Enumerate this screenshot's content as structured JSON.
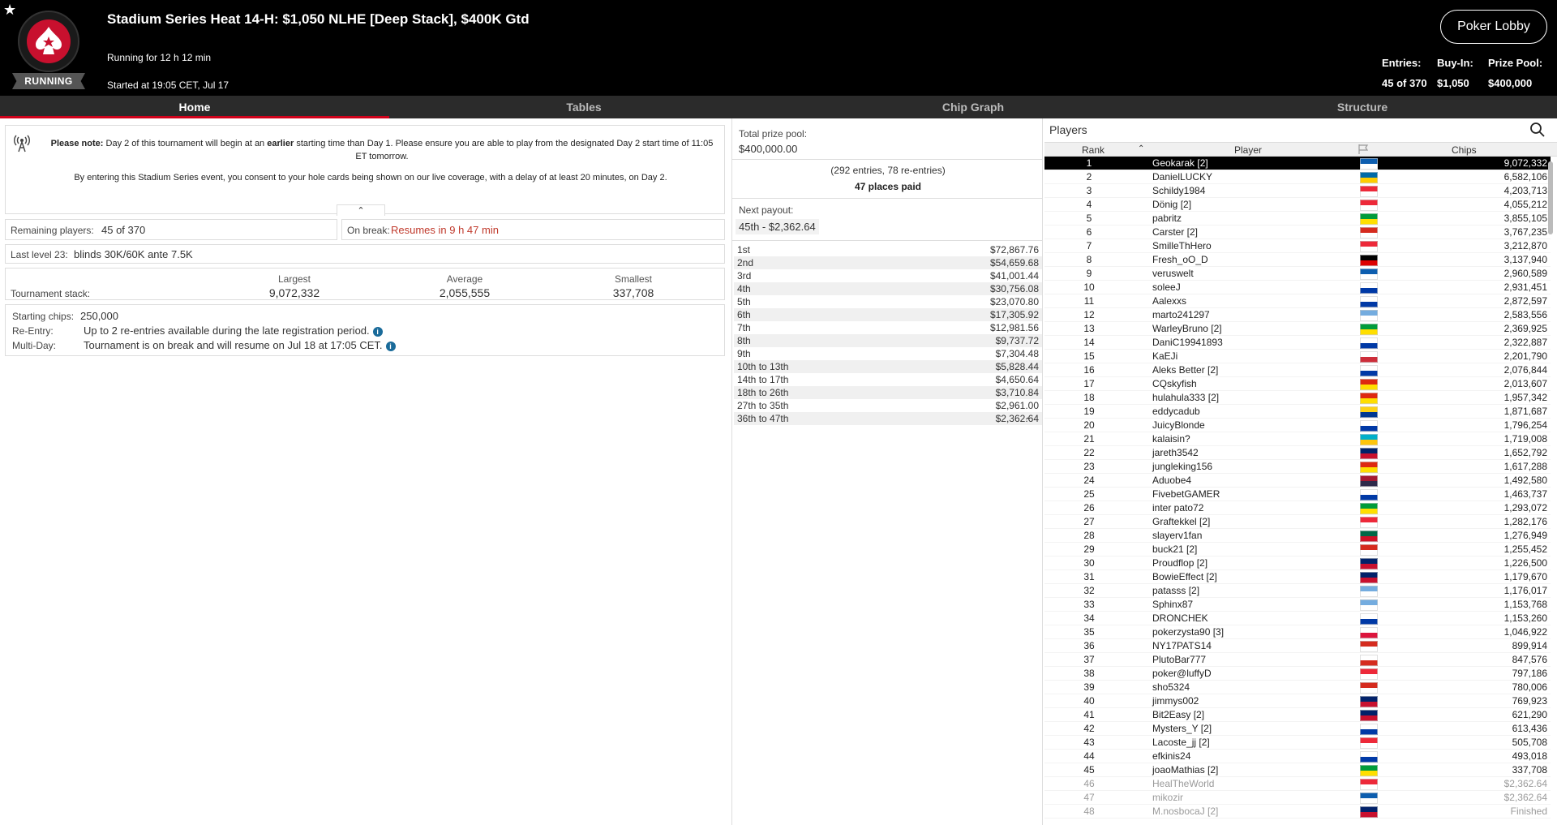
{
  "header": {
    "title": "Stadium Series Heat 14-H: $1,050 NLHE [Deep Stack], $400K Gtd",
    "status_badge": "RUNNING",
    "running_for": "Running for 12 h 12 min",
    "started_at": "Started at 19:05 CET, Jul 17",
    "lobby_button": "Poker Lobby",
    "entries_label": "Entries:",
    "entries_value": "45 of 370",
    "buyin_label": "Buy-In:",
    "buyin_value": "$1,050",
    "prizepool_label": "Prize Pool:",
    "prizepool_value": "$400,000"
  },
  "tabs": [
    {
      "label": "Home",
      "active": true
    },
    {
      "label": "Tables",
      "active": false
    },
    {
      "label": "Chip Graph",
      "active": false
    },
    {
      "label": "Structure",
      "active": false
    }
  ],
  "notice": {
    "bold_prefix": "Please note:",
    "text1": " Day 2 of this tournament will begin at an ",
    "bold_mid": "earlier",
    "text2": " starting time than Day 1. Please ensure you are able to play from the designated Day 2 start time of 11:05 ET tomorrow.",
    "text3": "By entering this Stadium Series event, you consent to your hole cards being shown on our live coverage, with a delay of at least 20 minutes, on Day 2."
  },
  "remaining": {
    "label": "Remaining players:",
    "value": "45 of 370"
  },
  "on_break": {
    "label": "On break:",
    "value": "Resumes in 9 h 47 min"
  },
  "last_level": {
    "label": "Last level 23:",
    "value": "blinds 30K/60K ante 7.5K"
  },
  "stack": {
    "label": "Tournament stack:",
    "largest_label": "Largest",
    "largest": "9,072,332",
    "average_label": "Average",
    "average": "2,055,555",
    "smallest_label": "Smallest",
    "smallest": "337,708"
  },
  "info": {
    "starting_label": "Starting chips:",
    "starting_value": "250,000",
    "reentry_label": "Re-Entry:",
    "reentry_value": "Up to 2 re-entries available during the late registration period.",
    "multiday_label": "Multi-Day:",
    "multiday_value": "Tournament is on break and will resume on Jul 18 at 17:05 CET."
  },
  "prize": {
    "total_label": "Total prize pool:",
    "total_value": "$400,000.00",
    "entries_text": "(292 entries, 78 re-entries)",
    "places_paid": "47 places paid",
    "next_payout_label": "Next payout:",
    "next_payout_value": "45th - $2,362.64",
    "payouts": [
      {
        "place": "1st",
        "amount": "$72,867.76"
      },
      {
        "place": "2nd",
        "amount": "$54,659.68"
      },
      {
        "place": "3rd",
        "amount": "$41,001.44"
      },
      {
        "place": "4th",
        "amount": "$30,756.08"
      },
      {
        "place": "5th",
        "amount": "$23,070.80"
      },
      {
        "place": "6th",
        "amount": "$17,305.92"
      },
      {
        "place": "7th",
        "amount": "$12,981.56"
      },
      {
        "place": "8th",
        "amount": "$9,737.72"
      },
      {
        "place": "9th",
        "amount": "$7,304.48"
      },
      {
        "place": "10th to 13th",
        "amount": "$5,828.44"
      },
      {
        "place": "14th to 17th",
        "amount": "$4,650.64"
      },
      {
        "place": "18th to 26th",
        "amount": "$3,710.84"
      },
      {
        "place": "27th to 35th",
        "amount": "$2,961.00"
      },
      {
        "place": "36th to 47th",
        "amount": "$2,362.64"
      }
    ]
  },
  "players": {
    "title": "Players",
    "col_rank": "Rank",
    "col_player": "Player",
    "col_chips": "Chips",
    "rows": [
      {
        "rank": "1",
        "name": "Geokarak [2]",
        "chips": "9,072,332",
        "flag": [
          "#0d5eaf",
          "#ffffff"
        ]
      },
      {
        "rank": "2",
        "name": "DanielLUCKY",
        "chips": "6,582,106",
        "flag": [
          "#006aa7",
          "#fecc00"
        ]
      },
      {
        "rank": "3",
        "name": "Schildy1984",
        "chips": "4,203,713",
        "flag": [
          "#ed2939",
          "#ffffff"
        ]
      },
      {
        "rank": "4",
        "name": "Dönig [2]",
        "chips": "4,055,212",
        "flag": [
          "#ed2939",
          "#ffffff"
        ]
      },
      {
        "rank": "5",
        "name": "pabritz",
        "chips": "3,855,105",
        "flag": [
          "#009c3b",
          "#ffdf00"
        ]
      },
      {
        "rank": "6",
        "name": "Carster [2]",
        "chips": "3,767,235",
        "flag": [
          "#d52b1e",
          "#ffffff"
        ]
      },
      {
        "rank": "7",
        "name": "SmilleThHero",
        "chips": "3,212,870",
        "flag": [
          "#ed2939",
          "#ffffff"
        ]
      },
      {
        "rank": "8",
        "name": "Fresh_oO_D",
        "chips": "3,137,940",
        "flag": [
          "#000000",
          "#dd0000"
        ]
      },
      {
        "rank": "9",
        "name": "veruswelt",
        "chips": "2,960,589",
        "flag": [
          "#0d5eaf",
          "#ffffff"
        ]
      },
      {
        "rank": "10",
        "name": "soleeJ",
        "chips": "2,931,451",
        "flag": [
          "#ffffff",
          "#0039a6"
        ]
      },
      {
        "rank": "11",
        "name": "Aalexxs",
        "chips": "2,872,597",
        "flag": [
          "#ffffff",
          "#0039a6"
        ]
      },
      {
        "rank": "12",
        "name": "marto241297",
        "chips": "2,583,556",
        "flag": [
          "#74acdf",
          "#ffffff"
        ]
      },
      {
        "rank": "13",
        "name": "WarleyBruno [2]",
        "chips": "2,369,925",
        "flag": [
          "#009c3b",
          "#ffdf00"
        ]
      },
      {
        "rank": "14",
        "name": "DaniC19941893",
        "chips": "2,322,887",
        "flag": [
          "#ffffff",
          "#0039a6"
        ]
      },
      {
        "rank": "15",
        "name": "KaEJi",
        "chips": "2,201,790",
        "flag": [
          "#ffffff",
          "#cd2e3a"
        ]
      },
      {
        "rank": "16",
        "name": "Aleks Better [2]",
        "chips": "2,076,844",
        "flag": [
          "#ffffff",
          "#0039a6"
        ]
      },
      {
        "rank": "17",
        "name": "CQskyfish",
        "chips": "2,013,607",
        "flag": [
          "#de2910",
          "#ffde00"
        ]
      },
      {
        "rank": "18",
        "name": "hulahula333 [2]",
        "chips": "1,957,342",
        "flag": [
          "#de2910",
          "#ffde00"
        ]
      },
      {
        "rank": "19",
        "name": "eddycadub",
        "chips": "1,871,687",
        "flag": [
          "#fcd116",
          "#003893"
        ]
      },
      {
        "rank": "20",
        "name": "JuicyBlonde",
        "chips": "1,796,254",
        "flag": [
          "#ffffff",
          "#0039a6"
        ]
      },
      {
        "rank": "21",
        "name": "kalaisin?",
        "chips": "1,719,008",
        "flag": [
          "#00afca",
          "#fec50c"
        ]
      },
      {
        "rank": "22",
        "name": "jareth3542",
        "chips": "1,652,792",
        "flag": [
          "#012169",
          "#c8102e"
        ]
      },
      {
        "rank": "23",
        "name": "jungleking156",
        "chips": "1,617,288",
        "flag": [
          "#de2910",
          "#ffde00"
        ]
      },
      {
        "rank": "24",
        "name": "Aduobe4",
        "chips": "1,492,580",
        "flag": [
          "#a51931",
          "#2d2a4a"
        ]
      },
      {
        "rank": "25",
        "name": "FivebetGAMER",
        "chips": "1,463,737",
        "flag": [
          "#ffffff",
          "#0039a6"
        ]
      },
      {
        "rank": "26",
        "name": "inter pato72",
        "chips": "1,293,072",
        "flag": [
          "#009c3b",
          "#ffdf00"
        ]
      },
      {
        "rank": "27",
        "name": "Graftekkel [2]",
        "chips": "1,282,176",
        "flag": [
          "#ed2939",
          "#ffffff"
        ]
      },
      {
        "rank": "28",
        "name": "slayerv1fan",
        "chips": "1,276,949",
        "flag": [
          "#006847",
          "#ce1126"
        ]
      },
      {
        "rank": "29",
        "name": "buck21 [2]",
        "chips": "1,255,452",
        "flag": [
          "#d52b1e",
          "#ffffff"
        ]
      },
      {
        "rank": "30",
        "name": "Proudflop [2]",
        "chips": "1,226,500",
        "flag": [
          "#012169",
          "#c8102e"
        ]
      },
      {
        "rank": "31",
        "name": "BowieEffect [2]",
        "chips": "1,179,670",
        "flag": [
          "#012169",
          "#c8102e"
        ]
      },
      {
        "rank": "32",
        "name": "patasss [2]",
        "chips": "1,176,017",
        "flag": [
          "#74acdf",
          "#ffffff"
        ]
      },
      {
        "rank": "33",
        "name": "Sphinx87",
        "chips": "1,153,768",
        "flag": [
          "#74acdf",
          "#ffffff"
        ]
      },
      {
        "rank": "34",
        "name": "DRONCHEK",
        "chips": "1,153,260",
        "flag": [
          "#ffffff",
          "#0039a6"
        ]
      },
      {
        "rank": "35",
        "name": "pokerzysta90 [3]",
        "chips": "1,046,922",
        "flag": [
          "#ffffff",
          "#dc143c"
        ]
      },
      {
        "rank": "36",
        "name": "NY17PATS14",
        "chips": "899,914",
        "flag": [
          "#d52b1e",
          "#ffffff"
        ]
      },
      {
        "rank": "37",
        "name": "PlutoBar777",
        "chips": "847,576",
        "flag": [
          "#ffffff",
          "#d52b1e"
        ]
      },
      {
        "rank": "38",
        "name": "poker@luffyD",
        "chips": "797,186",
        "flag": [
          "#ed2939",
          "#ffffff"
        ]
      },
      {
        "rank": "39",
        "name": "sho5324",
        "chips": "780,006",
        "flag": [
          "#d52b1e",
          "#ffffff"
        ]
      },
      {
        "rank": "40",
        "name": "jimmys002",
        "chips": "769,923",
        "flag": [
          "#012169",
          "#c8102e"
        ]
      },
      {
        "rank": "41",
        "name": "Bit2Easy [2]",
        "chips": "621,290",
        "flag": [
          "#012169",
          "#c8102e"
        ]
      },
      {
        "rank": "42",
        "name": "Mysters_Y [2]",
        "chips": "613,436",
        "flag": [
          "#ffffff",
          "#0039a6"
        ]
      },
      {
        "rank": "43",
        "name": "Lacoste_jj [2]",
        "chips": "505,708",
        "flag": [
          "#ed2939",
          "#ffffff"
        ]
      },
      {
        "rank": "44",
        "name": "efkinis24",
        "chips": "493,018",
        "flag": [
          "#ffffff",
          "#0039a6"
        ]
      },
      {
        "rank": "45",
        "name": "joaoMathias [2]",
        "chips": "337,708",
        "flag": [
          "#009c3b",
          "#ffdf00"
        ]
      },
      {
        "rank": "46",
        "name": "HealTheWorld",
        "chips": "$2,362.64",
        "flag": [
          "#ed2939",
          "#ffffff"
        ],
        "finished": true
      },
      {
        "rank": "47",
        "name": "mikozir",
        "chips": "$2,362.64",
        "flag": [
          "#0d5eaf",
          "#ffffff"
        ],
        "finished": true
      },
      {
        "rank": "48",
        "name": "M.nosbocaJ [2]",
        "chips": "Finished",
        "flag": [
          "#012169",
          "#c8102e"
        ],
        "finished": true
      }
    ]
  },
  "colors": {
    "accent": "#d0021b",
    "header_bg": "#000000",
    "tabs_bg": "#2b2b2b",
    "on_break": "#c0392b"
  }
}
